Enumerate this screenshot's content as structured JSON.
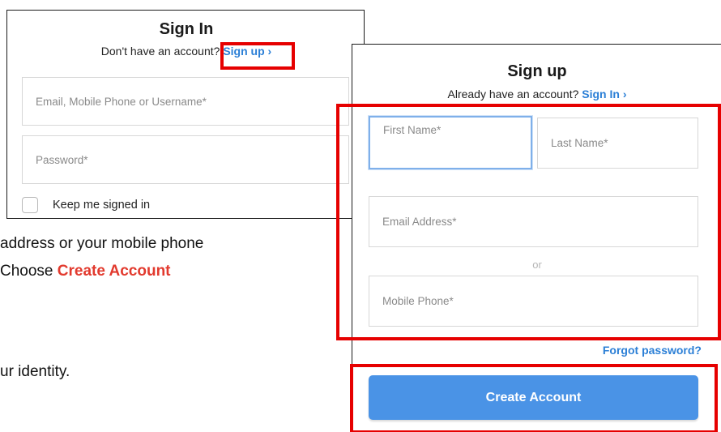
{
  "signin": {
    "title": "Sign In",
    "prompt": "Don't have an account?",
    "link": "Sign up ›",
    "email_placeholder": "Email, Mobile Phone or Username*",
    "password_placeholder": "Password*",
    "keep_signed_in": "Keep me signed in"
  },
  "document": {
    "line1": "address or your mobile phone",
    "line2_prefix": "Choose ",
    "line2_highlight": "Create Account",
    "line3": "ur identity."
  },
  "signup": {
    "title": "Sign up",
    "prompt": "Already have an account?",
    "link": "Sign In ›",
    "first_name_placeholder": "First Name*",
    "last_name_placeholder": "Last Name*",
    "email_placeholder": "Email Address*",
    "or_text": "or",
    "phone_placeholder": "Mobile Phone*",
    "forgot_password": "Forgot password?",
    "create_account": "Create Account"
  },
  "colors": {
    "link": "#2b7fd6",
    "button": "#4a93e6",
    "highlight": "#e60000",
    "doc_highlight": "#e23a2e"
  }
}
